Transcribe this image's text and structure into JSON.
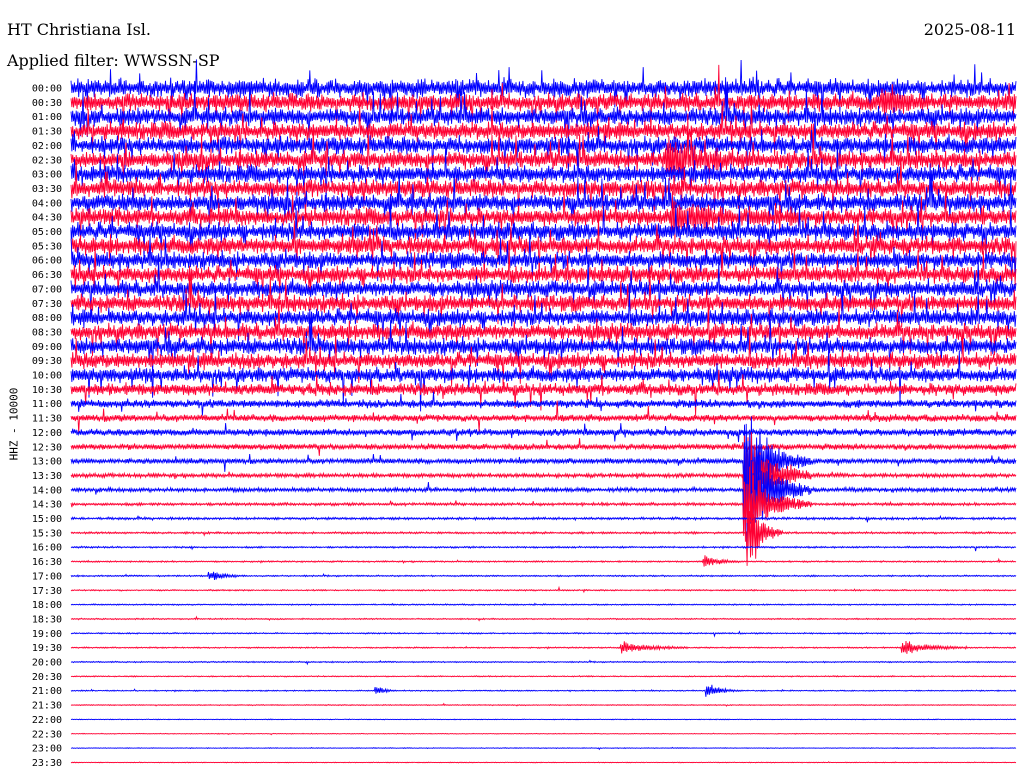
{
  "header": {
    "station": "HT Christiana Isl.",
    "date": "2025-08-11",
    "filter_text": "Applied filter: WWSSN-SP"
  },
  "channel_label": "HHZ - 10000",
  "colors": {
    "trace_a": "#0000ff",
    "trace_b": "#ff0033",
    "background": "#ffffff"
  },
  "chart_data": {
    "type": "helicorder",
    "title": "HT Christiana Isl.",
    "date": "2025-08-11",
    "filter": "WWSSN-SP",
    "channel": "HHZ - 10000",
    "line_interval_minutes": 30,
    "rows": [
      {
        "label": "00:00",
        "color": "blue",
        "noise": 0.95
      },
      {
        "label": "00:30",
        "color": "red",
        "noise": 0.95
      },
      {
        "label": "01:00",
        "color": "blue",
        "noise": 0.95
      },
      {
        "label": "01:30",
        "color": "red",
        "noise": 0.95
      },
      {
        "label": "02:00",
        "color": "blue",
        "noise": 0.95
      },
      {
        "label": "02:30",
        "color": "red",
        "noise": 0.95
      },
      {
        "label": "03:00",
        "color": "blue",
        "noise": 0.95
      },
      {
        "label": "03:30",
        "color": "red",
        "noise": 0.95
      },
      {
        "label": "04:00",
        "color": "blue",
        "noise": 0.95
      },
      {
        "label": "04:30",
        "color": "red",
        "noise": 0.95
      },
      {
        "label": "05:00",
        "color": "blue",
        "noise": 0.95
      },
      {
        "label": "05:30",
        "color": "red",
        "noise": 0.95
      },
      {
        "label": "06:00",
        "color": "blue",
        "noise": 0.9
      },
      {
        "label": "06:30",
        "color": "red",
        "noise": 0.9
      },
      {
        "label": "07:00",
        "color": "blue",
        "noise": 0.9
      },
      {
        "label": "07:30",
        "color": "red",
        "noise": 0.9
      },
      {
        "label": "08:00",
        "color": "blue",
        "noise": 0.9
      },
      {
        "label": "08:30",
        "color": "red",
        "noise": 0.9
      },
      {
        "label": "09:00",
        "color": "blue",
        "noise": 0.9
      },
      {
        "label": "09:30",
        "color": "red",
        "noise": 0.85
      },
      {
        "label": "10:00",
        "color": "blue",
        "noise": 0.8
      },
      {
        "label": "10:30",
        "color": "red",
        "noise": 0.65
      },
      {
        "label": "11:00",
        "color": "blue",
        "noise": 0.45
      },
      {
        "label": "11:30",
        "color": "red",
        "noise": 0.38
      },
      {
        "label": "12:00",
        "color": "blue",
        "noise": 0.38
      },
      {
        "label": "12:30",
        "color": "red",
        "noise": 0.32
      },
      {
        "label": "13:00",
        "color": "blue",
        "noise": 0.28
      },
      {
        "label": "13:30",
        "color": "red",
        "noise": 0.22
      },
      {
        "label": "14:00",
        "color": "blue",
        "noise": 0.22
      },
      {
        "label": "14:30",
        "color": "red",
        "noise": 0.15
      },
      {
        "label": "15:00",
        "color": "blue",
        "noise": 0.13
      },
      {
        "label": "15:30",
        "color": "red",
        "noise": 0.11
      },
      {
        "label": "16:00",
        "color": "blue",
        "noise": 0.09
      },
      {
        "label": "16:30",
        "color": "red",
        "noise": 0.08
      },
      {
        "label": "17:00",
        "color": "blue",
        "noise": 0.08
      },
      {
        "label": "17:30",
        "color": "red",
        "noise": 0.07
      },
      {
        "label": "18:00",
        "color": "blue",
        "noise": 0.07
      },
      {
        "label": "18:30",
        "color": "red",
        "noise": 0.07
      },
      {
        "label": "19:00",
        "color": "blue",
        "noise": 0.07
      },
      {
        "label": "19:30",
        "color": "red",
        "noise": 0.07
      },
      {
        "label": "20:00",
        "color": "blue",
        "noise": 0.07
      },
      {
        "label": "20:30",
        "color": "red",
        "noise": 0.06
      },
      {
        "label": "21:00",
        "color": "blue",
        "noise": 0.06
      },
      {
        "label": "21:30",
        "color": "red",
        "noise": 0.05
      },
      {
        "label": "22:00",
        "color": "blue",
        "noise": 0.04
      },
      {
        "label": "22:30",
        "color": "red",
        "noise": 0.04
      },
      {
        "label": "23:00",
        "color": "blue",
        "noise": 0.04
      },
      {
        "label": "23:30",
        "color": "red",
        "noise": 0.04
      }
    ],
    "events": [
      {
        "row": 1,
        "minute": 25.8,
        "amplitude": 1.5,
        "duration_min": 2
      },
      {
        "row": 5,
        "minute": 19.0,
        "amplitude": 2.5,
        "duration_min": 3
      },
      {
        "row": 9,
        "minute": 19.2,
        "amplitude": 2.0,
        "duration_min": 3
      },
      {
        "row": 26,
        "minute": 21.5,
        "amplitude": 8.0,
        "duration_min": 2
      },
      {
        "row": 27,
        "minute": 21.5,
        "amplitude": 9.0,
        "duration_min": 2
      },
      {
        "row": 28,
        "minute": 21.5,
        "amplitude": 10.0,
        "duration_min": 2
      },
      {
        "row": 29,
        "minute": 21.5,
        "amplitude": 7.0,
        "duration_min": 2
      },
      {
        "row": 31,
        "minute": 21.6,
        "amplitude": 6.0,
        "duration_min": 1
      },
      {
        "row": 33,
        "minute": 20.2,
        "amplitude": 1.2,
        "duration_min": 1
      },
      {
        "row": 34,
        "minute": 4.5,
        "amplitude": 0.8,
        "duration_min": 1
      },
      {
        "row": 39,
        "minute": 17.6,
        "amplitude": 1.0,
        "duration_min": 2
      },
      {
        "row": 39,
        "minute": 26.5,
        "amplitude": 1.2,
        "duration_min": 2
      },
      {
        "row": 42,
        "minute": 9.8,
        "amplitude": 0.6,
        "duration_min": 0.5
      },
      {
        "row": 42,
        "minute": 20.3,
        "amplitude": 1.0,
        "duration_min": 1
      }
    ]
  }
}
